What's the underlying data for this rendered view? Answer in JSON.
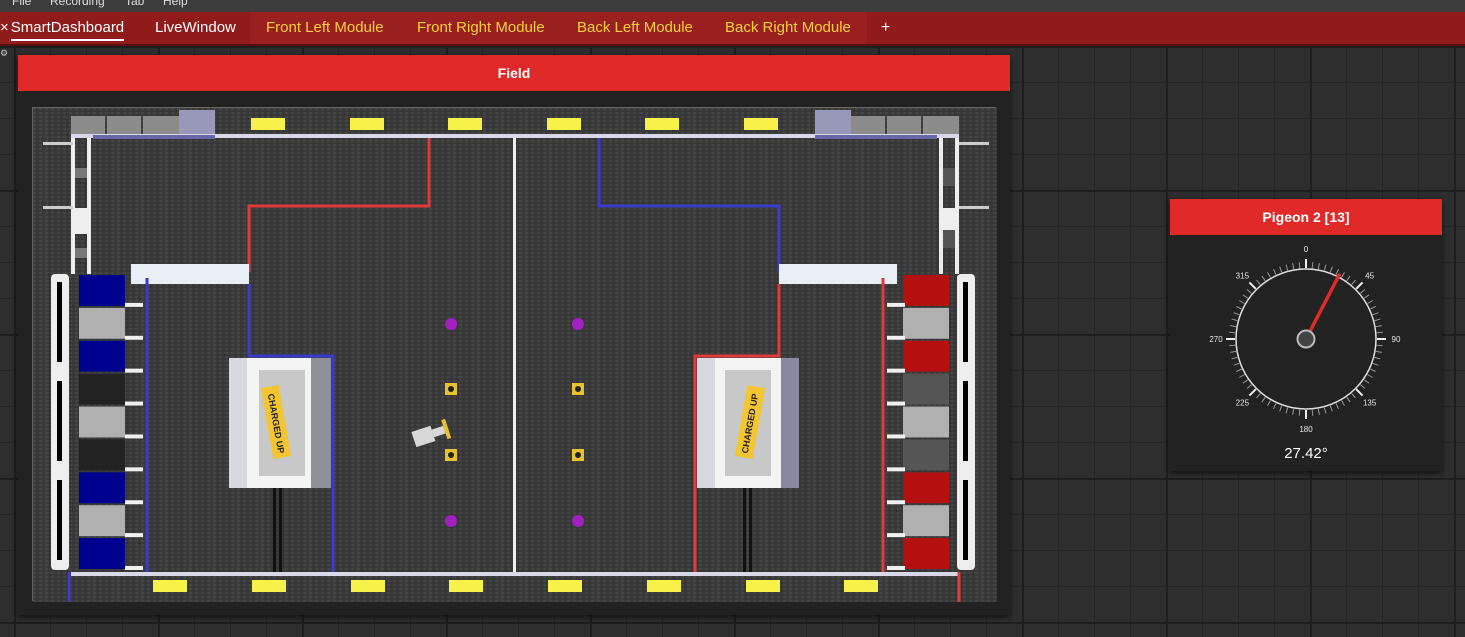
{
  "menu": {
    "items": [
      "File",
      "Recording",
      "Tab",
      "Help"
    ]
  },
  "tabs": [
    {
      "label": "SmartDashboard",
      "selected": true,
      "closable": true,
      "style": "plain"
    },
    {
      "label": "LiveWindow",
      "selected": false,
      "style": "plain"
    },
    {
      "label": "Front Left Module",
      "selected": false,
      "style": "module"
    },
    {
      "label": "Front Right Module",
      "selected": false,
      "style": "module"
    },
    {
      "label": "Back Left Module",
      "selected": false,
      "style": "module"
    },
    {
      "label": "Back Right Module",
      "selected": false,
      "style": "module"
    }
  ],
  "add_tab_label": "+",
  "close_glyph": "×",
  "field_widget": {
    "title": "Field",
    "game_logo_text": "CHARGED UP",
    "colors": {
      "carpet": "#3a3a3a",
      "alliance_blue": "#00008f",
      "alliance_red": "#b51010",
      "blue_line": "#3a3acc",
      "red_line": "#e03a3a",
      "cube_purple": "#a020c0",
      "cone_yellow": "#f7f24a"
    }
  },
  "gyro_widget": {
    "title": "Pigeon 2 [13]",
    "value_deg": 27.42,
    "value_text": "27.42°",
    "major_tick_labels": [
      "0",
      "45",
      "90",
      "135",
      "180",
      "225",
      "270",
      "315"
    ],
    "needle_color": "#e02a2a"
  },
  "theme": {
    "tab_bar_bg": "#8f1b1b",
    "widget_title_bg": "#e02a2a",
    "module_tab_text": "#f5d13a"
  }
}
